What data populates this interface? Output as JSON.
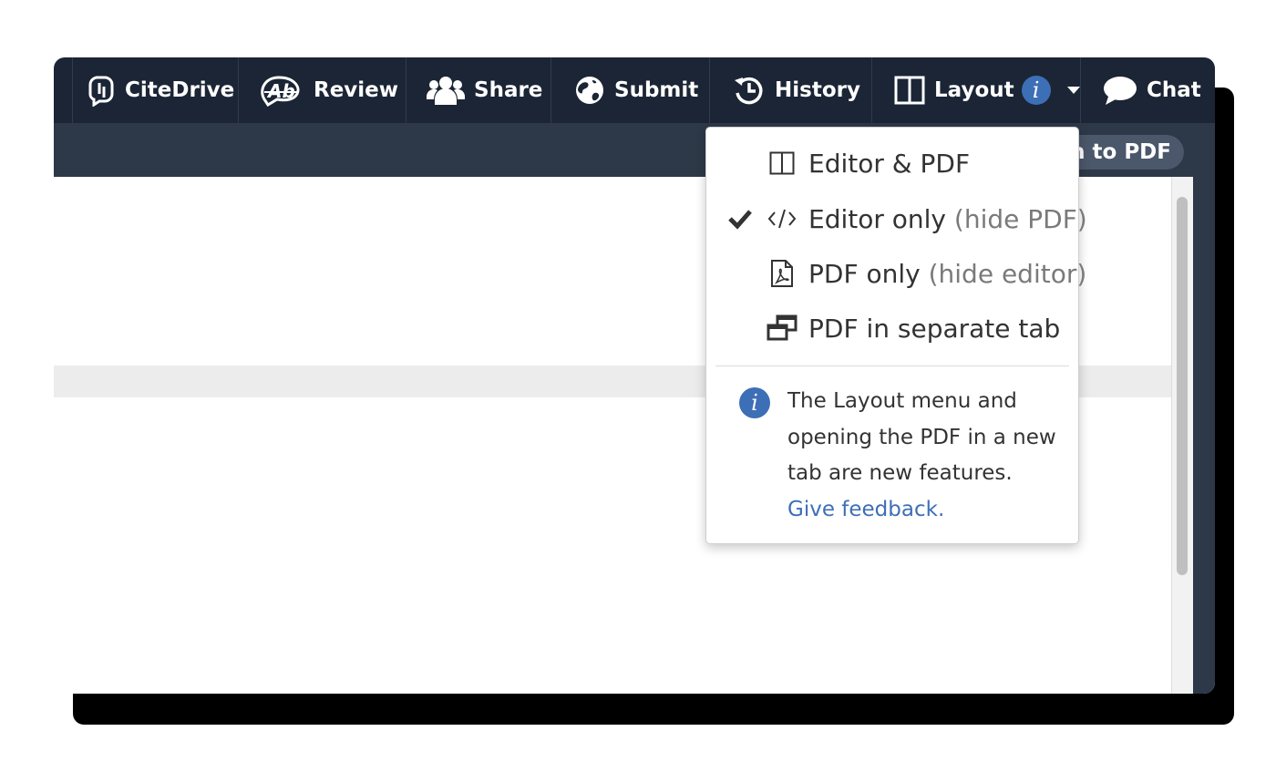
{
  "toolbar": {
    "items": [
      {
        "label": "CiteDrive",
        "icon": "citedrive-icon"
      },
      {
        "label": "Review",
        "icon": "review-icon"
      },
      {
        "label": "Share",
        "icon": "users-icon"
      },
      {
        "label": "Submit",
        "icon": "globe-icon"
      },
      {
        "label": "History",
        "icon": "history-icon"
      },
      {
        "label": "Layout",
        "icon": "columns-icon",
        "badge": "i"
      },
      {
        "label": "Chat",
        "icon": "chat-icon"
      }
    ]
  },
  "subbar": {
    "switch_label": "Switch to PDF",
    "visible_text": "h to PDF"
  },
  "layout_menu": {
    "items": [
      {
        "label": "Editor & PDF",
        "suffix": "",
        "icon": "split-view-icon",
        "checked": false
      },
      {
        "label": "Editor only",
        "suffix": "(hide PDF)",
        "icon": "code-icon",
        "checked": true
      },
      {
        "label": "PDF only",
        "suffix": "(hide editor)",
        "icon": "pdf-file-icon",
        "checked": false
      },
      {
        "label": "PDF in separate tab",
        "suffix": "",
        "icon": "new-window-icon",
        "checked": false
      }
    ],
    "note": {
      "icon_text": "i",
      "text": "The Layout menu and opening the PDF in a new tab are new features.",
      "link": "Give feedback."
    }
  },
  "colors": {
    "toolbar_bg": "#1b2535",
    "subbar_bg": "#2d3848",
    "accent": "#3d6fb6"
  }
}
